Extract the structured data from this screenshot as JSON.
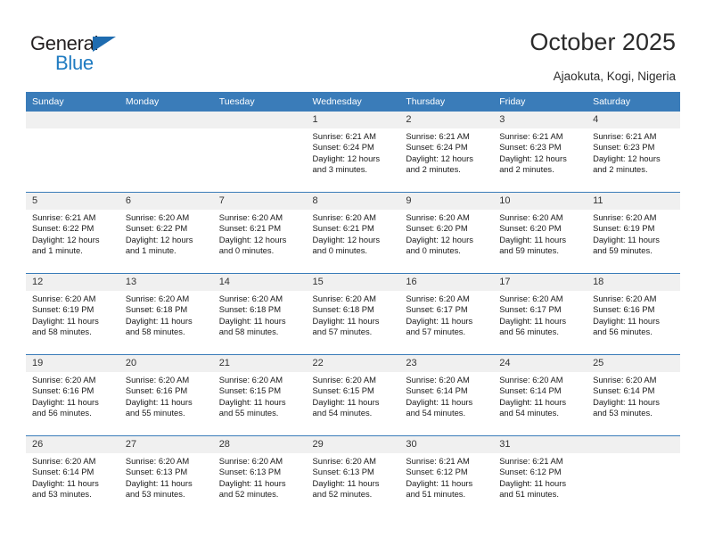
{
  "brand": {
    "name_part1": "General",
    "name_part2": "Blue",
    "triangle_color": "#1f6cb0",
    "blue_color": "#1f7bc1"
  },
  "header": {
    "title": "October 2025",
    "subtitle": "Ajaokuta, Kogi, Nigeria"
  },
  "colors": {
    "header_band": "#3a7cb9",
    "day_band": "#f0f0f0",
    "text": "#1a1a1a"
  },
  "weekday_headers": [
    "Sunday",
    "Monday",
    "Tuesday",
    "Wednesday",
    "Thursday",
    "Friday",
    "Saturday"
  ],
  "weeks": [
    [
      {
        "date": "",
        "lines": [
          "",
          "",
          "",
          ""
        ]
      },
      {
        "date": "",
        "lines": [
          "",
          "",
          "",
          ""
        ]
      },
      {
        "date": "",
        "lines": [
          "",
          "",
          "",
          ""
        ]
      },
      {
        "date": "1",
        "lines": [
          "Sunrise: 6:21 AM",
          "Sunset: 6:24 PM",
          "Daylight: 12 hours",
          "and 3 minutes."
        ]
      },
      {
        "date": "2",
        "lines": [
          "Sunrise: 6:21 AM",
          "Sunset: 6:24 PM",
          "Daylight: 12 hours",
          "and 2 minutes."
        ]
      },
      {
        "date": "3",
        "lines": [
          "Sunrise: 6:21 AM",
          "Sunset: 6:23 PM",
          "Daylight: 12 hours",
          "and 2 minutes."
        ]
      },
      {
        "date": "4",
        "lines": [
          "Sunrise: 6:21 AM",
          "Sunset: 6:23 PM",
          "Daylight: 12 hours",
          "and 2 minutes."
        ]
      }
    ],
    [
      {
        "date": "5",
        "lines": [
          "Sunrise: 6:21 AM",
          "Sunset: 6:22 PM",
          "Daylight: 12 hours",
          "and 1 minute."
        ]
      },
      {
        "date": "6",
        "lines": [
          "Sunrise: 6:20 AM",
          "Sunset: 6:22 PM",
          "Daylight: 12 hours",
          "and 1 minute."
        ]
      },
      {
        "date": "7",
        "lines": [
          "Sunrise: 6:20 AM",
          "Sunset: 6:21 PM",
          "Daylight: 12 hours",
          "and 0 minutes."
        ]
      },
      {
        "date": "8",
        "lines": [
          "Sunrise: 6:20 AM",
          "Sunset: 6:21 PM",
          "Daylight: 12 hours",
          "and 0 minutes."
        ]
      },
      {
        "date": "9",
        "lines": [
          "Sunrise: 6:20 AM",
          "Sunset: 6:20 PM",
          "Daylight: 12 hours",
          "and 0 minutes."
        ]
      },
      {
        "date": "10",
        "lines": [
          "Sunrise: 6:20 AM",
          "Sunset: 6:20 PM",
          "Daylight: 11 hours",
          "and 59 minutes."
        ]
      },
      {
        "date": "11",
        "lines": [
          "Sunrise: 6:20 AM",
          "Sunset: 6:19 PM",
          "Daylight: 11 hours",
          "and 59 minutes."
        ]
      }
    ],
    [
      {
        "date": "12",
        "lines": [
          "Sunrise: 6:20 AM",
          "Sunset: 6:19 PM",
          "Daylight: 11 hours",
          "and 58 minutes."
        ]
      },
      {
        "date": "13",
        "lines": [
          "Sunrise: 6:20 AM",
          "Sunset: 6:18 PM",
          "Daylight: 11 hours",
          "and 58 minutes."
        ]
      },
      {
        "date": "14",
        "lines": [
          "Sunrise: 6:20 AM",
          "Sunset: 6:18 PM",
          "Daylight: 11 hours",
          "and 58 minutes."
        ]
      },
      {
        "date": "15",
        "lines": [
          "Sunrise: 6:20 AM",
          "Sunset: 6:18 PM",
          "Daylight: 11 hours",
          "and 57 minutes."
        ]
      },
      {
        "date": "16",
        "lines": [
          "Sunrise: 6:20 AM",
          "Sunset: 6:17 PM",
          "Daylight: 11 hours",
          "and 57 minutes."
        ]
      },
      {
        "date": "17",
        "lines": [
          "Sunrise: 6:20 AM",
          "Sunset: 6:17 PM",
          "Daylight: 11 hours",
          "and 56 minutes."
        ]
      },
      {
        "date": "18",
        "lines": [
          "Sunrise: 6:20 AM",
          "Sunset: 6:16 PM",
          "Daylight: 11 hours",
          "and 56 minutes."
        ]
      }
    ],
    [
      {
        "date": "19",
        "lines": [
          "Sunrise: 6:20 AM",
          "Sunset: 6:16 PM",
          "Daylight: 11 hours",
          "and 56 minutes."
        ]
      },
      {
        "date": "20",
        "lines": [
          "Sunrise: 6:20 AM",
          "Sunset: 6:16 PM",
          "Daylight: 11 hours",
          "and 55 minutes."
        ]
      },
      {
        "date": "21",
        "lines": [
          "Sunrise: 6:20 AM",
          "Sunset: 6:15 PM",
          "Daylight: 11 hours",
          "and 55 minutes."
        ]
      },
      {
        "date": "22",
        "lines": [
          "Sunrise: 6:20 AM",
          "Sunset: 6:15 PM",
          "Daylight: 11 hours",
          "and 54 minutes."
        ]
      },
      {
        "date": "23",
        "lines": [
          "Sunrise: 6:20 AM",
          "Sunset: 6:14 PM",
          "Daylight: 11 hours",
          "and 54 minutes."
        ]
      },
      {
        "date": "24",
        "lines": [
          "Sunrise: 6:20 AM",
          "Sunset: 6:14 PM",
          "Daylight: 11 hours",
          "and 54 minutes."
        ]
      },
      {
        "date": "25",
        "lines": [
          "Sunrise: 6:20 AM",
          "Sunset: 6:14 PM",
          "Daylight: 11 hours",
          "and 53 minutes."
        ]
      }
    ],
    [
      {
        "date": "26",
        "lines": [
          "Sunrise: 6:20 AM",
          "Sunset: 6:14 PM",
          "Daylight: 11 hours",
          "and 53 minutes."
        ]
      },
      {
        "date": "27",
        "lines": [
          "Sunrise: 6:20 AM",
          "Sunset: 6:13 PM",
          "Daylight: 11 hours",
          "and 53 minutes."
        ]
      },
      {
        "date": "28",
        "lines": [
          "Sunrise: 6:20 AM",
          "Sunset: 6:13 PM",
          "Daylight: 11 hours",
          "and 52 minutes."
        ]
      },
      {
        "date": "29",
        "lines": [
          "Sunrise: 6:20 AM",
          "Sunset: 6:13 PM",
          "Daylight: 11 hours",
          "and 52 minutes."
        ]
      },
      {
        "date": "30",
        "lines": [
          "Sunrise: 6:21 AM",
          "Sunset: 6:12 PM",
          "Daylight: 11 hours",
          "and 51 minutes."
        ]
      },
      {
        "date": "31",
        "lines": [
          "Sunrise: 6:21 AM",
          "Sunset: 6:12 PM",
          "Daylight: 11 hours",
          "and 51 minutes."
        ]
      },
      {
        "date": "",
        "lines": [
          "",
          "",
          "",
          ""
        ]
      }
    ]
  ]
}
